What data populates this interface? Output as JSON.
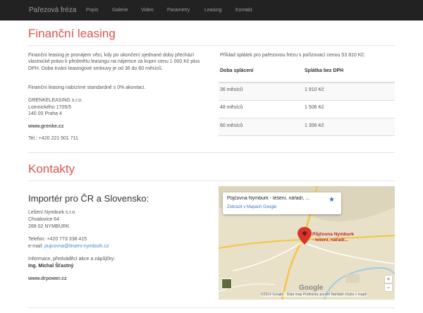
{
  "nav": {
    "brand": "Pařezová fréza",
    "items": [
      "Popis",
      "Galerie",
      "Video",
      "Parametry",
      "Leasing",
      "Kontakt"
    ]
  },
  "leasing": {
    "title": "Finanční leasing",
    "description": "Finanční leasing je pronájem věci, kdy po ukončení sjednané doby přechází vlastnické právo k předmětu leasingu na nájemce za kupní cenu 1 000 Kč plus DPH. Doba trvání leasingové smlouvy je od 36 do 60 měsíců.",
    "note": "Finanční leasing nabízíme standardně s 0% akontací.",
    "company": [
      "GRENKELEASING s.r.o.",
      "Lomnického 1705/5",
      "140 00 Praha 4"
    ],
    "web": "www.grenke.cz",
    "phone": "Tel.: +420 221 501 711"
  },
  "table": {
    "caption": "Příklad splátek pro pařezovou frézu s pořizovací cenou 53 810 Kč:",
    "headers": [
      "Doba splácení",
      "Splátka bez DPH"
    ],
    "rows": [
      [
        "36 měsíců",
        "1 910 Kč"
      ],
      [
        "48 měsíců",
        "1 506 Kč"
      ],
      [
        "60 měsíců",
        "1 356 Kč"
      ]
    ]
  },
  "contacts": {
    "title": "Kontakty",
    "importer_title": "Importér pro ČR a Slovensko:",
    "address": [
      "Lešení Nymburk s.r.o.",
      "Chvalovice 64",
      "288 02 NYMBURK"
    ],
    "phone": "Telefon: +420 773 338 415",
    "email_label": "e-mail:",
    "email": "pujcovna@leseni-nymburk.cz",
    "handover_label": "Informace, předváděcí akce a zápůjčky:",
    "handover_person": "Ing. Michal Šťastný",
    "web": "www.drpower.cz"
  },
  "map": {
    "card_title": "Půjčovna Nymburk - lešení, nářadí, ...",
    "card_link": "Zobrazit v Mapách Google",
    "pin_label": [
      "Půjčovna Nymburk",
      "- lešení, nářadí..."
    ],
    "google": "Google",
    "footer": "©2014 Google · Data map   Podmínky použití   Nahlásit chybu v mapě",
    "zoom_in": "+",
    "zoom_out": "−",
    "colors": {
      "land": "#e8e1c8",
      "road": "#f5c542",
      "water": "#9ecbe6",
      "pin": "#d9342b"
    }
  },
  "colors": {
    "accent": "#d9534f",
    "link": "#428bca",
    "navbar": "#222222"
  }
}
